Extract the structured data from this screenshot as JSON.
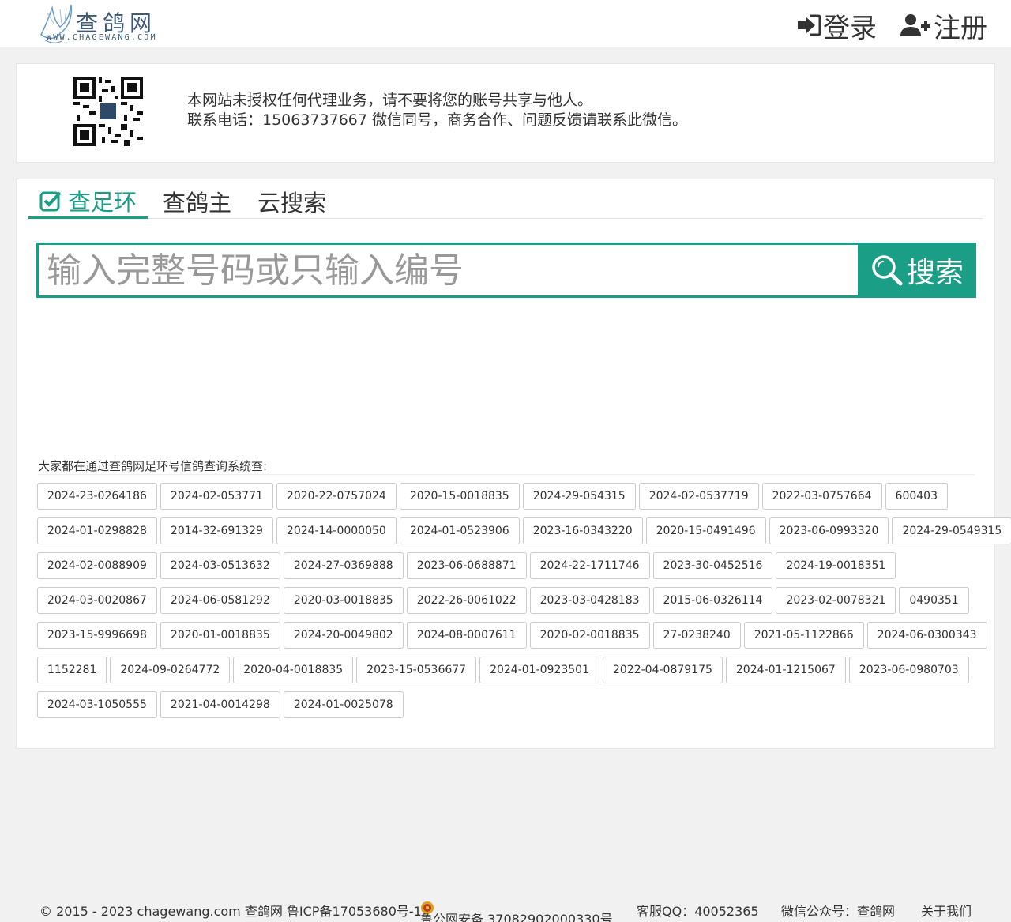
{
  "header": {
    "logo_text": "查鸽网",
    "logo_sub": "WWW.CHAGEWANG.COM",
    "login_label": "登录",
    "register_label": "注册"
  },
  "notice": {
    "line1": "本网站未授权任何代理业务，请不要将您的账号共享与他人。",
    "line2": "联系电话：15063737667 微信同号，商务合作、问题反馈请联系此微信。"
  },
  "tabs": [
    {
      "label": "查足环",
      "active": true
    },
    {
      "label": "查鸽主",
      "active": false
    },
    {
      "label": "云搜索",
      "active": false
    }
  ],
  "search": {
    "placeholder": "输入完整号码或只输入编号",
    "button_label": "搜索"
  },
  "recent": {
    "title": "大家都在通过查鸽网足环号信鸽查询系统查:",
    "rows": [
      [
        "2024-23-0264186",
        "2024-02-053771",
        "2020-22-0757024",
        "2020-15-0018835",
        "2024-29-054315",
        "2024-02-0537719",
        "2022-03-0757664",
        "600403"
      ],
      [
        "2024-01-0298828",
        "2014-32-691329",
        "2024-14-0000050",
        "2024-01-0523906",
        "2023-16-0343220",
        "2020-15-0491496",
        "2023-06-0993320",
        "2024-29-0549315"
      ],
      [
        "2024-02-0088909",
        "2024-03-0513632",
        "2024-27-0369888",
        "2023-06-0688871",
        "2024-22-1711746",
        "2023-30-0452516",
        "2024-19-0018351"
      ],
      [
        "2024-03-0020867",
        "2024-06-0581292",
        "2020-03-0018835",
        "2022-26-0061022",
        "2023-03-0428183",
        "2015-06-0326114",
        "2023-02-0078321",
        "0490351"
      ],
      [
        "2023-15-9996698",
        "2020-01-0018835",
        "2024-20-0049802",
        "2024-08-0007611",
        "2020-02-0018835",
        "27-0238240",
        "2021-05-1122866",
        "2024-06-0300343"
      ],
      [
        "1152281",
        "2024-09-0264772",
        "2020-04-0018835",
        "2023-15-0536677",
        "2024-01-0923501",
        "2022-04-0879175",
        "2024-01-1215067",
        "2023-06-0980703"
      ],
      [
        "2024-03-1050555",
        "2021-04-0014298",
        "2024-01-0025078"
      ]
    ]
  },
  "footer": {
    "copyright": "© 2015 - 2023 chagewang.com 查鸽网 鲁ICP备17053680号-1",
    "police": "鲁公网安备 37082902000330号",
    "qq": "客服QQ：40052365",
    "wechat": "微信公众号：查鸽网",
    "about": "关于我们"
  },
  "colors": {
    "accent": "#1a9e86",
    "background": "#f1f1f1"
  }
}
